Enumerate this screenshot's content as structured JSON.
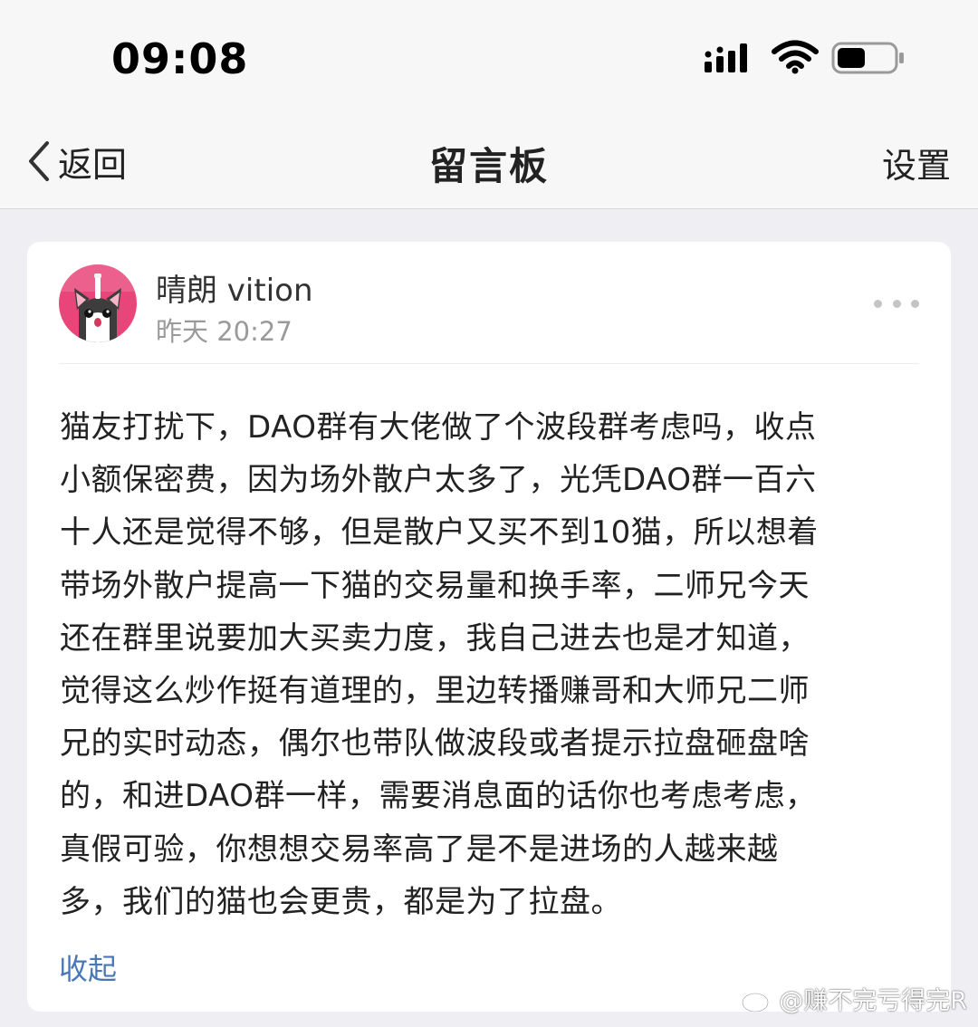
{
  "status_bar": {
    "time": "09:08",
    "battery_level": 0.5
  },
  "nav": {
    "back_label": "返回",
    "title": "留言板",
    "settings_label": "设置"
  },
  "post": {
    "author": "晴朗 vition",
    "time": "昨天 20:27",
    "lines": [
      "猫友打扰下，DAO群有大佬做了个波段群考虑吗，收点",
      "小额保密费，因为场外散户太多了，光凭DAO群一百六",
      "十人还是觉得不够，但是散户又买不到10猫，所以想着",
      "带场外散户提高一下猫的交易量和换手率，二师兄今天",
      "还在群里说要加大买卖力度，我自己进去也是才知道，",
      "觉得这么炒作挺有道理的，里边转播赚哥和大师兄二师",
      "兄的实时动态，偶尔也带队做波段或者提示拉盘砸盘啥",
      "的，和进DAO群一样，需要消息面的话你也考虑考虑，",
      "真假可验，你想想交易率高了是不是进场的人越来越",
      "多，我们的猫也会更贵，都是为了拉盘。"
    ],
    "collapse_label": "收起"
  },
  "watermark": {
    "text": "@赚不完亏得完R"
  },
  "colors": {
    "background": "#efeff3",
    "bar": "#f7f7f7",
    "link": "#4a78b5",
    "avatar_bg": "#e8467a"
  },
  "icons": {
    "back": "chevron-left-icon",
    "signal": "cellular-signal-icon",
    "wifi": "wifi-icon",
    "battery": "battery-icon",
    "more": "more-dots-icon",
    "watermark": "weibo-icon"
  }
}
